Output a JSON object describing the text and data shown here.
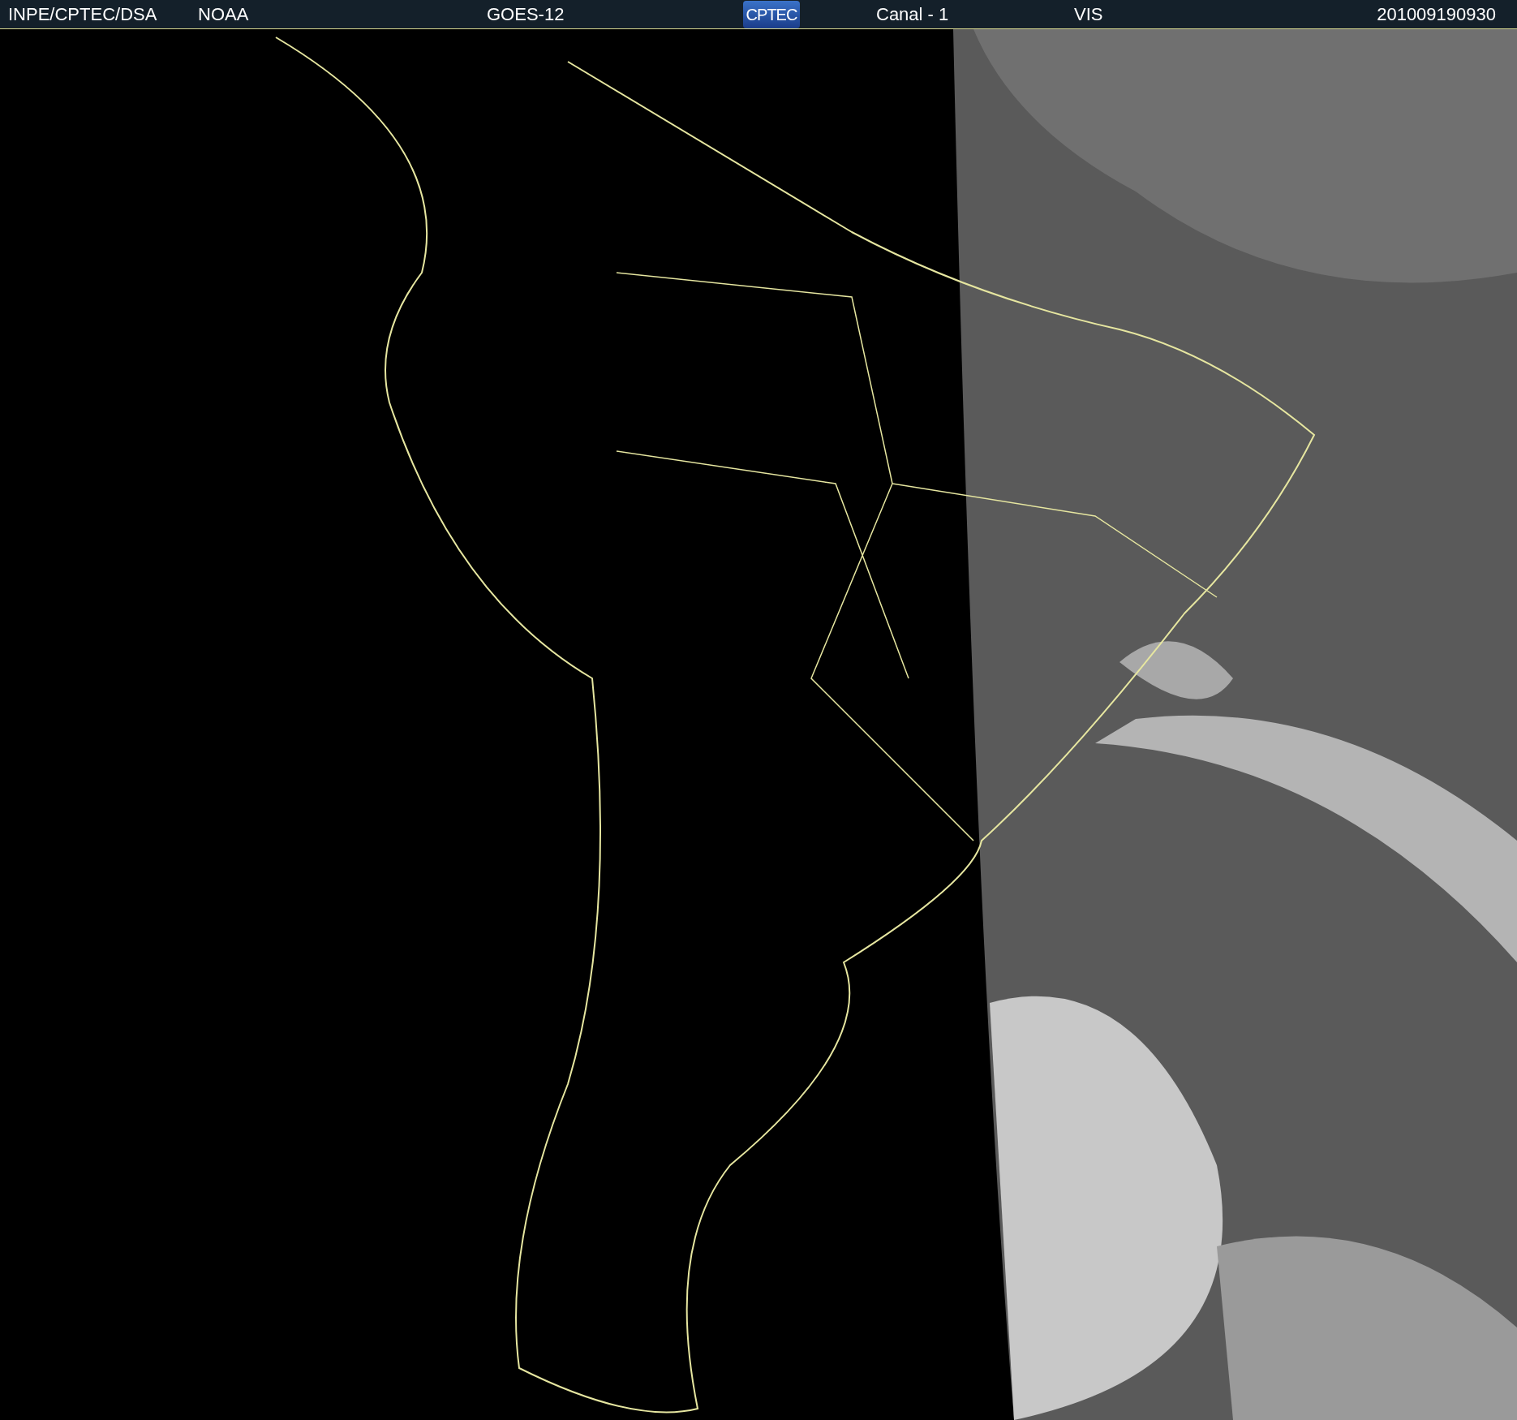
{
  "header": {
    "source": "INPE/CPTEC/DSA",
    "agency": "NOAA",
    "satellite": "GOES-12",
    "logo": "CPTEC",
    "channel": "Canal - 1",
    "band": "VIS",
    "timestamp": "201009190930"
  }
}
